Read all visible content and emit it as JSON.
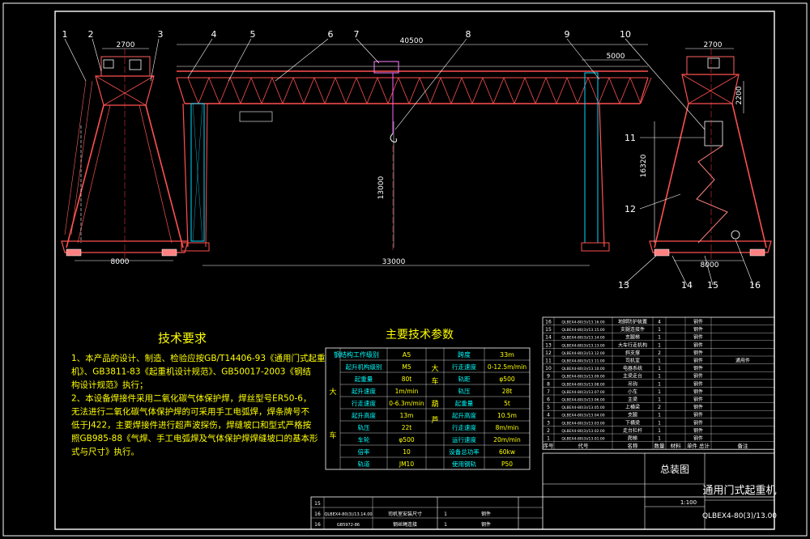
{
  "drawing": {
    "part_labels": [
      "1",
      "2",
      "3",
      "4",
      "5",
      "6",
      "7",
      "8",
      "9",
      "10",
      "11",
      "12",
      "13",
      "14",
      "15",
      "16"
    ],
    "dims": {
      "top_span": "40500",
      "left_leg_top": "2700",
      "right_leg_top": "2700",
      "right_offset": "5000",
      "span_bottom": "33000",
      "left_base": "8000",
      "right_base": "8000",
      "lift_height": "13000",
      "right_height": "16320",
      "right_box": "2200"
    }
  },
  "tech": {
    "title": "技术要求",
    "lines": [
      "1、本产品的设计、制造、检验应按GB/T14406-93《通用门式起重",
      "机》、GB3811-83《起重机设计规范》、GB50017-2003《钢结",
      "构设计规范》执行；",
      "2、本设备焊接件采用二氧化碳气体保护焊，焊丝型号ER50-6，",
      "无法进行二氧化碳气体保护焊的可采用手工电弧焊，焊条牌号不",
      "低于J422，主要焊接件进行超声波探伤，焊缝坡口和型式严格按",
      "照GB985-88《气焊、手工电弧焊及气体保护焊焊缝坡口的基本形",
      "式与尺寸》执行。"
    ]
  },
  "params": {
    "title": "主要技术参数",
    "header": [
      "钢结构工作级别",
      "A5",
      "跨度",
      "33m"
    ],
    "side_left": [
      "大",
      "车"
    ],
    "side_mid_top": [
      "大",
      "车"
    ],
    "side_mid_bot": [
      "葫",
      "芦"
    ],
    "rows": [
      [
        "起升机构级别",
        "M5",
        "行走速度",
        "0-12.5m/min"
      ],
      [
        "起重量",
        "80t",
        "轨距",
        "φ500"
      ],
      [
        "起升速度",
        "1m/min",
        "轨压",
        "28t"
      ],
      [
        "行走速度",
        "0-6.3m/min",
        "起重量",
        "5t"
      ],
      [
        "起升高度",
        "13m",
        "起升高度",
        "10.5m"
      ],
      [
        "轨压",
        "22t",
        "行走速度",
        "8m/min"
      ],
      [
        "车轮",
        "φ500",
        "运行速度",
        "20m/min"
      ],
      [
        "倍率",
        "10",
        "设备总功率",
        "60kw"
      ],
      [
        "轨道",
        "JM10",
        "使用钢轨",
        "P50"
      ]
    ]
  },
  "parts": {
    "rows": [
      [
        "16",
        "QLBEX4-80(3)/13.16.00",
        "地脚防护装置",
        "4",
        "",
        "钢件",
        ""
      ],
      [
        "15",
        "QLBEX4-80(3)/13.15.00",
        "支腿连接件",
        "1",
        "",
        "钢件",
        ""
      ],
      [
        "14",
        "QLBEX4-80(3)/13.14.00",
        "支腿梯",
        "1",
        "",
        "钢件",
        ""
      ],
      [
        "13",
        "QLBEX4-80(3)/13.13.00",
        "大车行走机构",
        "1",
        "",
        "钢件",
        ""
      ],
      [
        "12",
        "QLBEX4-80(3)/13.12.00",
        "斜支撑",
        "2",
        "",
        "钢件",
        ""
      ],
      [
        "11",
        "QLBEX4-80(3)/13.11.00",
        "司机室",
        "1",
        "",
        "钢件",
        "通用件"
      ],
      [
        "10",
        "QLBEX4-80(3)/13.10.00",
        "电器系统",
        "1",
        "",
        "钢件",
        ""
      ],
      [
        "9",
        "QLBEX4-80(3)/13.09.00",
        "主梁走台",
        "1",
        "",
        "钢件",
        ""
      ],
      [
        "8",
        "QLBEX4-80(3)/13.08.00",
        "吊钩",
        "1",
        "",
        "钢件",
        ""
      ],
      [
        "7",
        "QLBEX4-80(3)/13.07.00",
        "小车",
        "1",
        "",
        "钢件",
        ""
      ],
      [
        "6",
        "QLBEX4-80(3)/13.06.00",
        "主梁",
        "1",
        "",
        "钢件",
        ""
      ],
      [
        "5",
        "QLBEX4-80(3)/13.05.00",
        "上横梁",
        "2",
        "",
        "钢件",
        ""
      ],
      [
        "4",
        "QLBEX4-80(3)/13.04.00",
        "支腿",
        "1",
        "",
        "钢件",
        ""
      ],
      [
        "3",
        "QLBEX4-80(3)/13.03.00",
        "下横梁",
        "1",
        "",
        "钢件",
        ""
      ],
      [
        "2",
        "QLBEX4-80(3)/13.02.00",
        "走台栏杆",
        "1",
        "",
        "钢件",
        ""
      ],
      [
        "1",
        "QLBEX4-80(3)/13.01.00",
        "爬梯",
        "1",
        "",
        "钢件",
        ""
      ]
    ],
    "header": [
      "序号",
      "代号",
      "名称",
      "数量",
      "材料",
      "单件 总计",
      "备注"
    ]
  },
  "title_block": {
    "drawing_title": "总装图",
    "product_name": "通用门式起重机",
    "drawing_no": "QLBEX4-80(3)/13.00",
    "scale": "1:100",
    "left_rows": [
      [
        "15",
        "",
        "",
        "",
        ""
      ],
      [
        "16",
        "QLBEX4-80(3)/13.14.00",
        "司机室安装尺寸",
        "1",
        "钢件"
      ],
      [
        "16",
        "GB5972-86",
        "钢丝绳连接",
        "1",
        "钢件"
      ]
    ]
  }
}
